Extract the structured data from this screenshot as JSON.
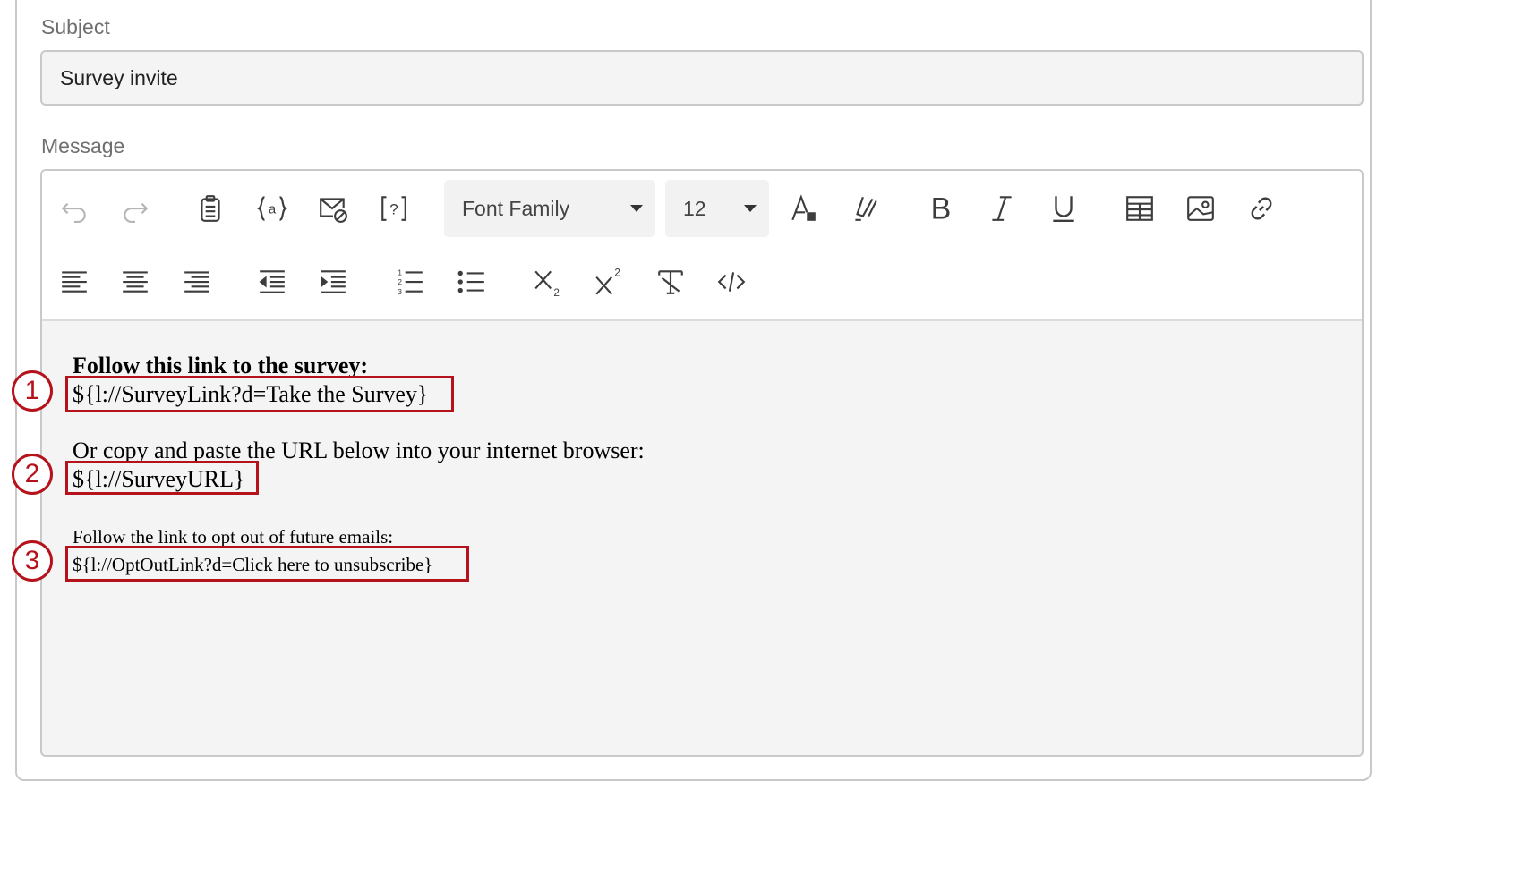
{
  "subject": {
    "label": "Subject",
    "value": "Survey invite"
  },
  "message": {
    "label": "Message"
  },
  "toolbar": {
    "font_family": "Font Family",
    "font_size": "12",
    "buttons_row1": [
      "undo-icon",
      "redo-icon",
      "clipboard-icon",
      "piped-text-icon",
      "email-block-icon",
      "help-bracket-icon",
      "text-color-icon",
      "highlight-icon",
      "bold-icon",
      "italic-icon",
      "underline-icon",
      "table-icon",
      "image-icon",
      "link-icon"
    ],
    "buttons_row2": [
      "align-left-icon",
      "align-center-icon",
      "align-right-icon",
      "outdent-icon",
      "indent-icon",
      "numbered-list-icon",
      "bulleted-list-icon",
      "subscript-icon",
      "superscript-icon",
      "clear-format-icon",
      "source-code-icon"
    ]
  },
  "body": {
    "heading": "Follow this link to the survey:",
    "survey_link": "${l://SurveyLink?d=Take the Survey}",
    "copy_text": "Or copy and paste the URL below into your internet browser:",
    "survey_url": "${l://SurveyURL}",
    "optout_text": "Follow the link to opt out of future emails:",
    "optout_link": "${l://OptOutLink?d=Click here to unsubscribe}"
  },
  "callouts": [
    "1",
    "2",
    "3"
  ],
  "colors": {
    "accent": "#b5121b",
    "border": "#c9c9c9",
    "field_bg": "#f4f4f4"
  }
}
